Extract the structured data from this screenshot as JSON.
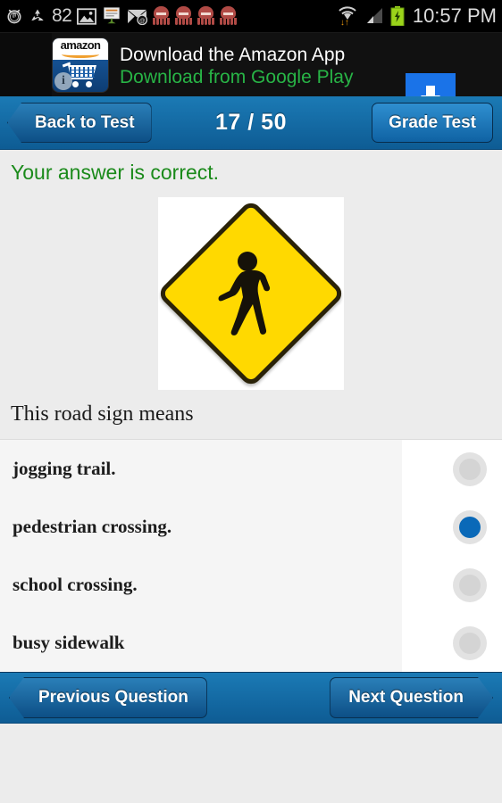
{
  "status_bar": {
    "icons": [
      "alarm-clock-icon",
      "recycle-icon",
      "gallery-icon",
      "presentation-icon",
      "mail-at-icon",
      "octopus-icon",
      "octopus-icon",
      "octopus-icon",
      "octopus-icon"
    ],
    "battery_number": "82",
    "wifi_icon": "wifi-icon",
    "signal_icon": "cell-signal-icon",
    "battery_icon": "battery-charging-icon",
    "time": "10:57 PM"
  },
  "ad": {
    "brand": "amazon",
    "info_badge": "i",
    "line1": "Download the Amazon App",
    "line2": "Download from Google Play",
    "button_icon": "download-arrow-icon",
    "line2_color": "#28b446"
  },
  "header": {
    "back_label": "Back to Test",
    "counter": "17 / 50",
    "grade_label": "Grade Test",
    "bar_color": "#0e5c94"
  },
  "main": {
    "feedback": "Your answer is correct.",
    "feedback_color": "#1a8a1a",
    "sign_icon": "pedestrian-crossing-sign",
    "sign_color": "#ffd900",
    "question": "This road sign means"
  },
  "options": [
    {
      "label": "jogging trail.",
      "selected": false
    },
    {
      "label": "pedestrian crossing.",
      "selected": true
    },
    {
      "label": "school crossing.",
      "selected": false
    },
    {
      "label": "busy sidewalk",
      "selected": false
    }
  ],
  "selected_color": "#0a69b8",
  "nav": {
    "previous_label": "Previous Question",
    "next_label": "Next Question"
  }
}
